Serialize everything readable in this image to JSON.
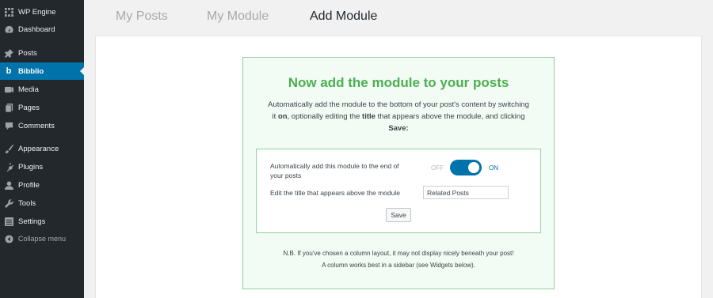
{
  "sidebar": {
    "items": [
      {
        "label": "WP Engine",
        "icon": "wp-engine-icon"
      },
      {
        "label": "Dashboard",
        "icon": "dashboard-icon"
      },
      {
        "label": "Posts",
        "icon": "pin-icon"
      },
      {
        "label": "Bibblio",
        "icon": "bibblio-icon",
        "active": true
      },
      {
        "label": "Media",
        "icon": "media-icon"
      },
      {
        "label": "Pages",
        "icon": "pages-icon"
      },
      {
        "label": "Comments",
        "icon": "comments-icon"
      },
      {
        "label": "Appearance",
        "icon": "brush-icon"
      },
      {
        "label": "Plugins",
        "icon": "plug-icon"
      },
      {
        "label": "Profile",
        "icon": "user-icon"
      },
      {
        "label": "Tools",
        "icon": "wrench-icon"
      },
      {
        "label": "Settings",
        "icon": "settings-icon"
      },
      {
        "label": "Collapse menu",
        "icon": "collapse-icon"
      }
    ]
  },
  "tabs": [
    {
      "label": "My Posts"
    },
    {
      "label": "My Module"
    },
    {
      "label": "Add Module",
      "current": true
    }
  ],
  "main": {
    "heading": "Now add the module to your posts",
    "description": {
      "line1": "Automatically add the module to the bottom of your post's content by switching",
      "line2_pre": "it ",
      "line2_on": "on",
      "line2_mid": ", optionally editing the ",
      "line2_title": "title",
      "line2_post": " that appears above the module, and clicking",
      "line3": "Save:"
    },
    "auto_add_label_1": "Automatically add this module to the end of",
    "auto_add_label_2": "your posts",
    "toggle": {
      "off_label": "OFF",
      "on_label": "ON",
      "state": "on"
    },
    "title_label": "Edit the title that appears above the module",
    "title_value": "Related Posts",
    "save_label": "Save",
    "note_line1": "N.B. If you've chosen a column layout, it may not display nicely beneath your post!",
    "note_line2": "A column works best in a sidebar (see Widgets below)."
  },
  "colors": {
    "sidebar_bg": "#23282d",
    "active_item": "#0073aa",
    "heading_green": "#4caf50",
    "box_border": "#8fd19e",
    "toggle_blue": "#0073aa"
  }
}
